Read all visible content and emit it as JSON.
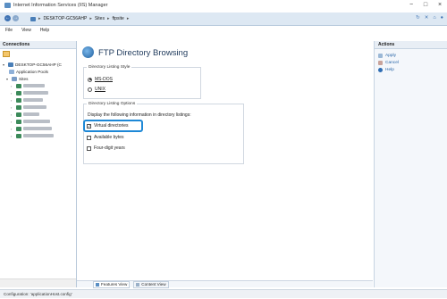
{
  "window": {
    "title": "Internet Information Services (IIS) Manager",
    "minimize": "−",
    "maximize": "□",
    "close": "×"
  },
  "address": {
    "back": "←",
    "forward": "→",
    "crumbs": [
      "DESKTOP-GC56AHP",
      "Sites",
      "ftpsite"
    ],
    "separator": "▸",
    "right_icons": [
      "refresh-icon",
      "stop-icon",
      "home-icon",
      "help-icon"
    ]
  },
  "menu": {
    "items": [
      "File",
      "View",
      "Help"
    ]
  },
  "connections": {
    "header": "Connections",
    "tree": {
      "server": "DESKTOP-GC56AHP (C",
      "app_pools": "Application Pools",
      "sites": "Sites"
    }
  },
  "content": {
    "title": "FTP Directory Browsing",
    "listing_style": {
      "legend": "Directory Listing Style",
      "options": [
        {
          "label": "MS-DOS",
          "selected": true
        },
        {
          "label": "UNIX",
          "selected": false
        }
      ]
    },
    "listing_options": {
      "legend": "Directory Listing Options",
      "description": "Display the following information in directory listings:",
      "items": [
        {
          "label": "Virtual directories",
          "checked": true
        },
        {
          "label": "Available bytes",
          "checked": false
        },
        {
          "label": "Four-digit years",
          "checked": false
        }
      ]
    },
    "tabs": [
      "Features View",
      "Content View"
    ]
  },
  "actions": {
    "header": "Actions",
    "items": [
      {
        "label": "Apply",
        "icon": "apply-icon"
      },
      {
        "label": "Cancel",
        "icon": "cancel-icon"
      },
      {
        "label": "Help",
        "icon": "help-icon"
      }
    ]
  },
  "status": {
    "text": "Configuration: 'applicationHost.config'"
  },
  "colors": {
    "accent": "#1e88d6",
    "link": "#2563a6",
    "header_bg": "#e8eef5"
  }
}
